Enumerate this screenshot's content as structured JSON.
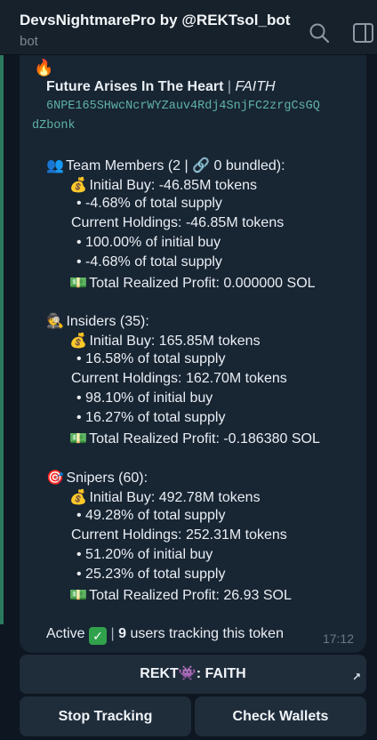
{
  "header": {
    "title": "DevsNightmarePro by @REKTsol_bot",
    "subtitle": "bot"
  },
  "message": {
    "fire_emoji": "🔥",
    "token_name": "Future Arises In The Heart",
    "separator": "|",
    "ticker": "FAITH",
    "address_line1": "6NPE165SHwcNcrWYZauv4Rdj4SnjFC2zrgCsGQ",
    "address_line2": "dZbonk",
    "team": {
      "emoji": "👥",
      "heading": "Team Members (2 | 🔗 0 bundled):",
      "initial_buy": "Initial Buy: -46.85M tokens",
      "initial_pct": "• -4.68% of total supply",
      "current": "Current Holdings: -46.85M tokens",
      "current_pct_initial": "• 100.00% of initial buy",
      "current_pct_total": "• -4.68% of total supply",
      "profit": "Total Realized Profit: 0.000000 SOL"
    },
    "insiders": {
      "emoji": "🕵",
      "heading": "Insiders (35):",
      "initial_buy": "Initial Buy: 165.85M tokens",
      "initial_pct": "• 16.58% of total supply",
      "current": "Current Holdings: 162.70M tokens",
      "current_pct_initial": "• 98.10% of initial buy",
      "current_pct_total": "• 16.27% of total supply",
      "profit": "Total Realized Profit: -0.186380 SOL"
    },
    "snipers": {
      "emoji": "🎯",
      "heading": "Snipers (60):",
      "initial_buy": "Initial Buy: 492.78M tokens",
      "initial_pct": "• 49.28% of total supply",
      "current": "Current Holdings: 252.31M tokens",
      "current_pct_initial": "• 51.20% of initial buy",
      "current_pct_total": "• 25.23% of total supply",
      "profit": "Total Realized Profit: 26.93 SOL"
    },
    "money_bag_emoji": "💰",
    "money_emoji": "💵",
    "status_prefix": "Active",
    "check_mark": "✓",
    "status_sep": "|",
    "users_count": "9",
    "status_suffix": "users tracking this token",
    "time": "17:12"
  },
  "keyboard": {
    "rekt_label": "REKT👾: FAITH",
    "stop_label": "Stop Tracking",
    "wallets_label": "Check Wallets"
  }
}
